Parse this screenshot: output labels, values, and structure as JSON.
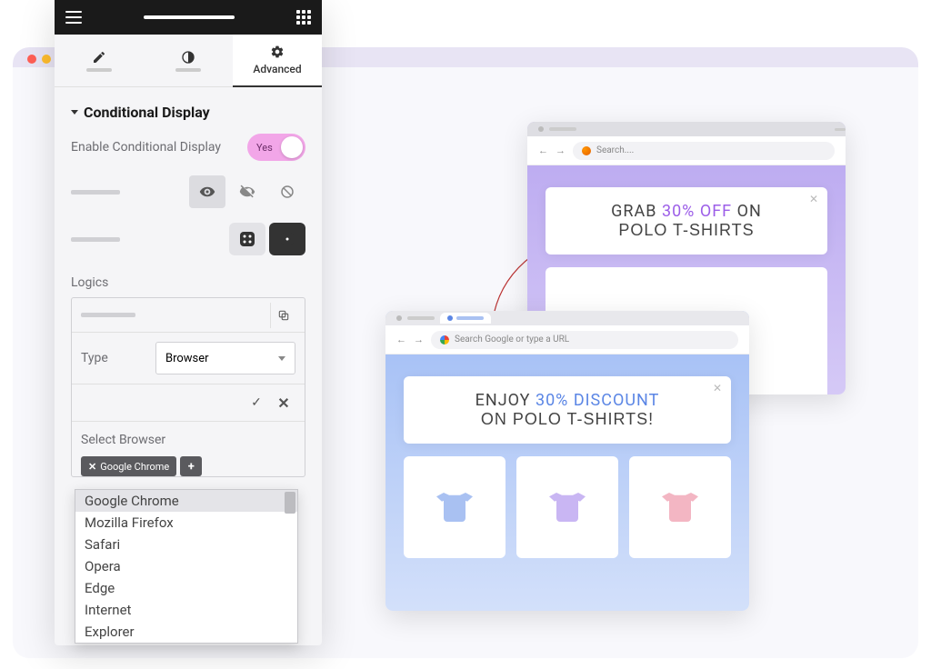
{
  "tabs": {
    "advanced": "Advanced"
  },
  "section": {
    "title": "Conditional Display",
    "enable_label": "Enable Conditional Display",
    "toggle_text": "Yes"
  },
  "logics": {
    "heading": "Logics",
    "type_label": "Type",
    "type_value": "Browser",
    "select_label": "Select Browser",
    "selected_chip": "Google Chrome",
    "options": [
      "Google Chrome",
      "Mozilla Firefox",
      "Safari",
      "Opera",
      "Edge",
      "Internet",
      "Explorer"
    ]
  },
  "preview": {
    "firefox": {
      "search_placeholder": "Search....",
      "banner_line1_pre": "GRAB ",
      "banner_line1_accent": "30% OFF",
      "banner_line1_post": " ON",
      "banner_line2": "POLO T-SHIRTS"
    },
    "chrome": {
      "search_placeholder": "Search Google or type a URL",
      "banner_line1_pre": "ENJOY ",
      "banner_line1_accent": "30% DISCOUNT",
      "banner_line2": "ON POLO T-SHIRTS!"
    }
  }
}
